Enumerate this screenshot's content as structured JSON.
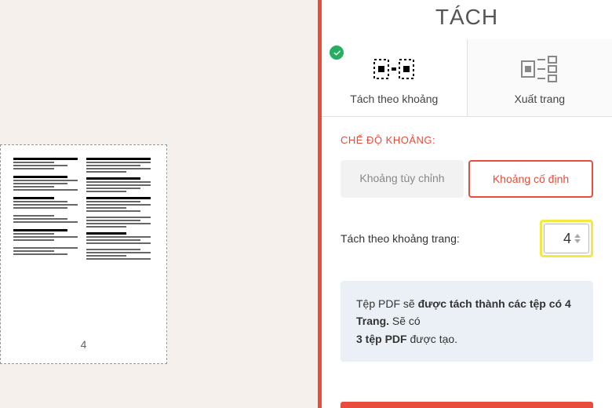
{
  "title_partial": "TÁCH",
  "preview": {
    "page_number": "4"
  },
  "modes": {
    "split_range": {
      "label": "Tách theo khoảng"
    },
    "extract_pages": {
      "label": "Xuất trang"
    }
  },
  "section_label": "CHẾ ĐỘ KHOẢNG:",
  "range_toggle": {
    "custom": "Khoảng tùy chỉnh",
    "fixed": "Khoảng cố định"
  },
  "range_input": {
    "label": "Tách theo khoảng trang:",
    "value": "4"
  },
  "info": {
    "line1_pre": "Tệp PDF sẽ ",
    "line1_bold": "được tách thành các tệp có 4 Trang.",
    "line2_pre": " Sẽ có",
    "line3_bold": "3 tệp PDF",
    "line3_post": " được tạo."
  }
}
